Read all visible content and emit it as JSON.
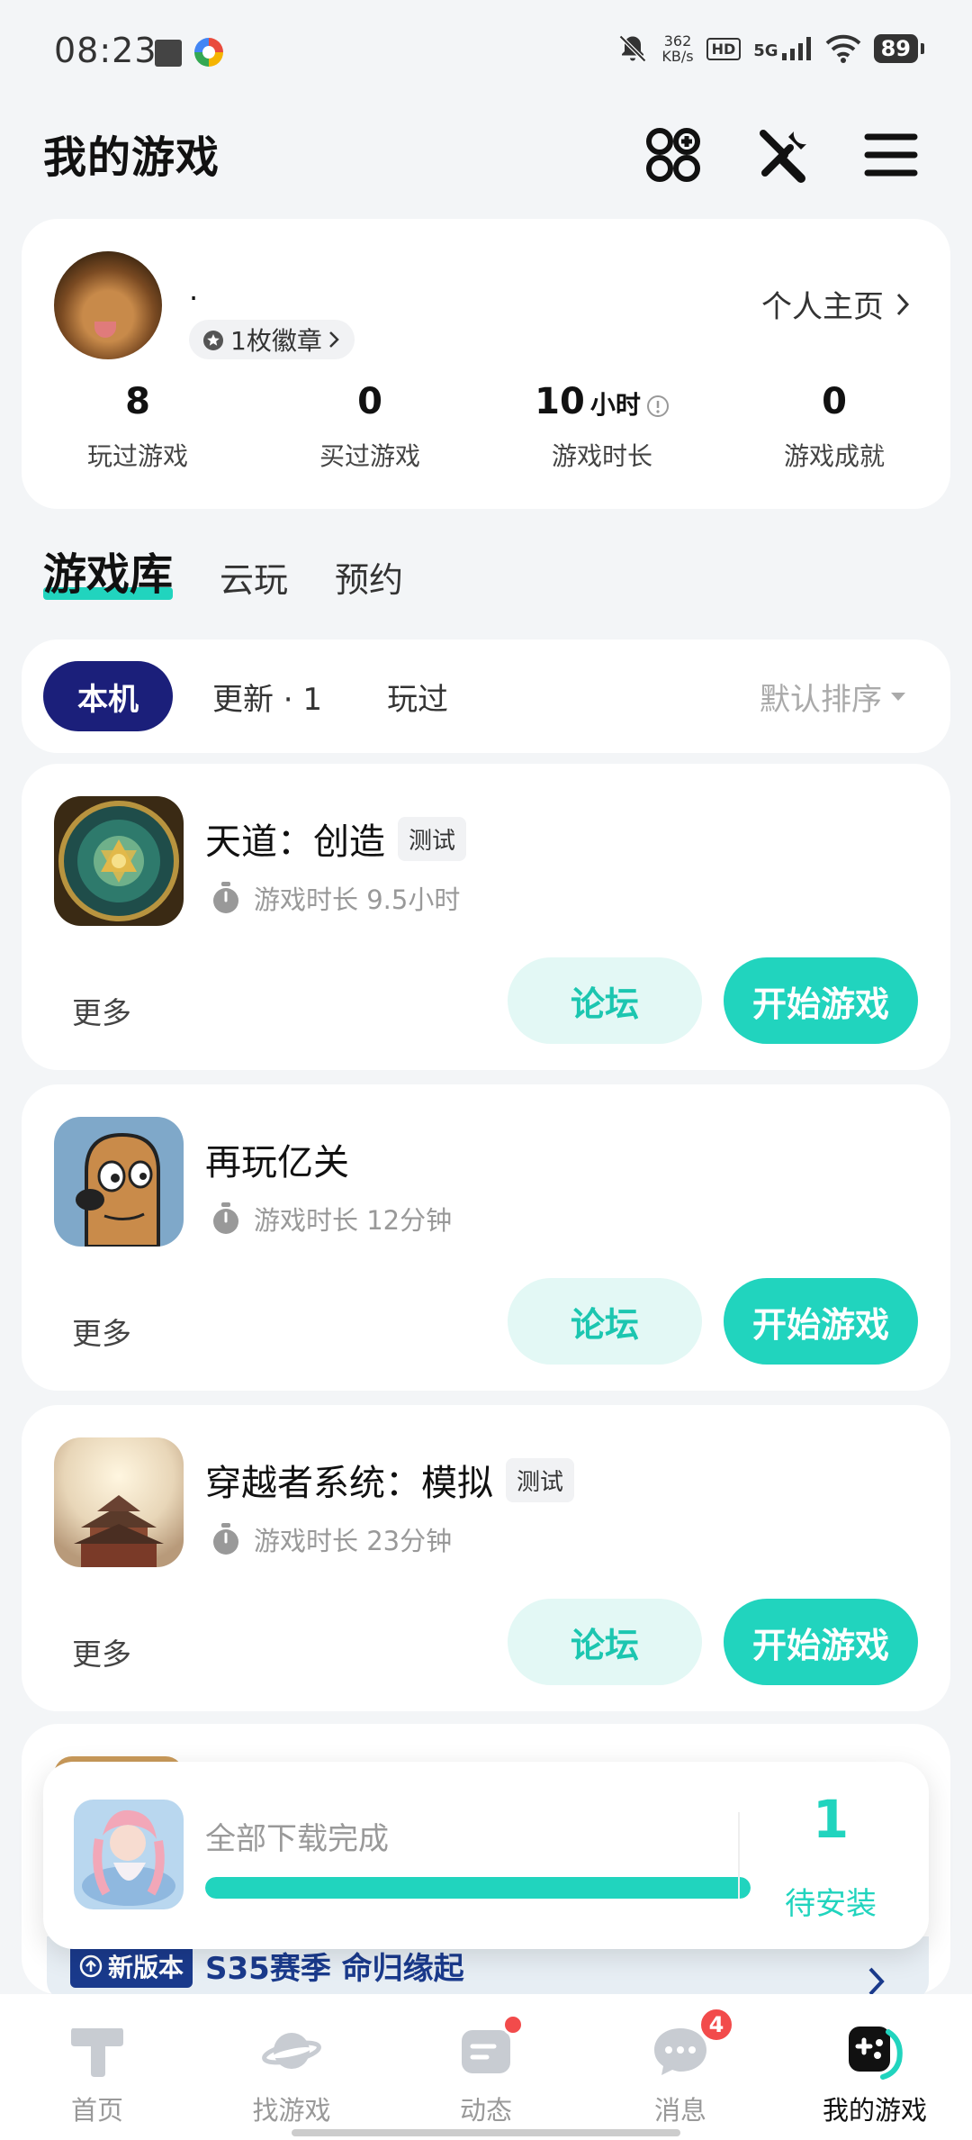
{
  "status_bar": {
    "time": "08:23",
    "net_speed_value": "362",
    "net_speed_unit": "KB/s",
    "hd_label": "HD",
    "network": "5G",
    "battery": "89"
  },
  "header": {
    "title": "我的游戏",
    "icons": [
      "apps-add-icon",
      "tools-icon",
      "menu-icon"
    ]
  },
  "profile": {
    "name": ".",
    "badge_label": "1枚徽章",
    "homepage_link": "个人主页",
    "stats": [
      {
        "value": "8",
        "unit": "",
        "label": "玩过游戏"
      },
      {
        "value": "0",
        "unit": "",
        "label": "买过游戏"
      },
      {
        "value": "10",
        "unit": "小时",
        "label": "游戏时长"
      },
      {
        "value": "0",
        "unit": "",
        "label": "游戏成就"
      }
    ]
  },
  "main_tabs": [
    {
      "label": "游戏库",
      "active": true
    },
    {
      "label": "云玩",
      "active": false
    },
    {
      "label": "预约",
      "active": false
    }
  ],
  "filters": {
    "chips": [
      {
        "label": "本机",
        "active": true
      },
      {
        "label": "更新 · 1",
        "active": false
      },
      {
        "label": "玩过",
        "active": false
      }
    ],
    "sort_label": "默认排序"
  },
  "games": [
    {
      "name": "天道：创造",
      "tag": "测试",
      "playtime": "游戏时长 9.5小时",
      "more": "更多",
      "forum": "论坛",
      "play": "开始游戏"
    },
    {
      "name": "再玩亿关",
      "tag": "",
      "playtime": "游戏时长 12分钟",
      "more": "更多",
      "forum": "论坛",
      "play": "开始游戏"
    },
    {
      "name": "穿越者系统：模拟",
      "tag": "测试",
      "playtime": "游戏时长 23分钟",
      "more": "更多",
      "forum": "论坛",
      "play": "开始游戏"
    }
  ],
  "partial_card": {
    "new_version_tag": "新版本",
    "new_version_text": "S35赛季 命归缘起"
  },
  "download_popup": {
    "status": "全部下载完成",
    "progress": 1.0,
    "pending_count": "1",
    "pending_label": "待安装"
  },
  "bottom_nav": [
    {
      "label": "首页",
      "icon": "home-icon",
      "active": false
    },
    {
      "label": "找游戏",
      "icon": "planet-icon",
      "active": false
    },
    {
      "label": "动态",
      "icon": "feed-icon",
      "active": false,
      "dot": true
    },
    {
      "label": "消息",
      "icon": "message-icon",
      "active": false,
      "count": "4"
    },
    {
      "label": "我的游戏",
      "icon": "gamepad-icon",
      "active": true
    }
  ],
  "colors": {
    "accent": "#21d4be",
    "active_chip": "#1b1f7a",
    "badge_red": "#f24b4b"
  }
}
